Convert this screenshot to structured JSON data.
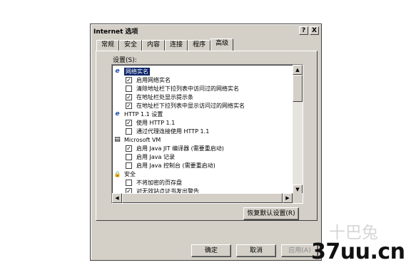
{
  "window": {
    "title": "Internet 选项",
    "help_btn": "?",
    "close_btn": "X"
  },
  "tabs": [
    {
      "label": "常规",
      "active": false
    },
    {
      "label": "安全",
      "active": false
    },
    {
      "label": "内容",
      "active": false
    },
    {
      "label": "连接",
      "active": false
    },
    {
      "label": "程序",
      "active": false
    },
    {
      "label": "高级",
      "active": true
    }
  ],
  "settings_label": "设置(S):",
  "settings_list": [
    {
      "type": "category",
      "icon": "ie-icon",
      "label": "网络实名",
      "selected": true
    },
    {
      "type": "checkbox",
      "label": "启用网络实名",
      "checked": true
    },
    {
      "type": "checkbox",
      "label": "清除地址栏下拉列表中访问过的网络实名",
      "checked": false
    },
    {
      "type": "checkbox",
      "label": "在地址栏处显示提示条",
      "checked": true
    },
    {
      "type": "checkbox",
      "label": "在地址栏下拉列表中显示访问过的网络实名",
      "checked": true
    },
    {
      "type": "category",
      "icon": "ie-icon",
      "label": "HTTP 1.1 设置"
    },
    {
      "type": "checkbox",
      "label": "使用 HTTP 1.1",
      "checked": true
    },
    {
      "type": "checkbox",
      "label": "通过代理连接使用 HTTP 1.1",
      "checked": false
    },
    {
      "type": "category",
      "icon": "document-icon",
      "label": "Microsoft VM"
    },
    {
      "type": "checkbox",
      "label": "启用 Java JIT 编译器 (需要重启动)",
      "checked": true
    },
    {
      "type": "checkbox",
      "label": "启用 Java 记录",
      "checked": false
    },
    {
      "type": "checkbox",
      "label": "启用 Java 控制台 (需要重启动)",
      "checked": false
    },
    {
      "type": "category",
      "icon": "lock-icon",
      "label": "安全"
    },
    {
      "type": "checkbox",
      "label": "不将加密的页存盘",
      "checked": false
    },
    {
      "type": "checkbox",
      "label": "对无效站点证书发出警告",
      "checked": true
    }
  ],
  "restore_button": "恢复默认设置(R)",
  "buttons": {
    "ok": "确定",
    "cancel": "取消",
    "apply": "应用(A)"
  },
  "watermark": {
    "site": "37uu.cn",
    "logo": "十巴兔"
  }
}
